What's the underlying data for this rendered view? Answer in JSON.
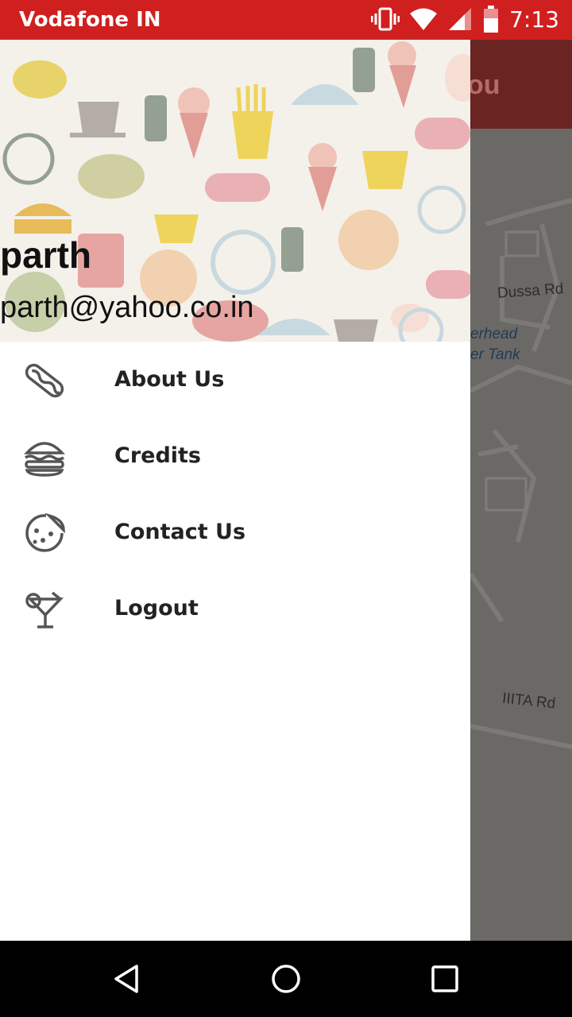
{
  "status_bar": {
    "carrier": "Vodafone IN",
    "time": "7:13",
    "icons": [
      "vibrate-icon",
      "wifi-icon",
      "cell-signal-icon",
      "battery-icon"
    ]
  },
  "background_app": {
    "title_fragment": "ou",
    "map_labels": [
      "Dussa Rd",
      "erhead",
      "er Tank",
      "IIITA Rd"
    ]
  },
  "drawer": {
    "header": {
      "name": "parth",
      "email": "parth@yahoo.co.in"
    },
    "items": [
      {
        "label": "About Us",
        "icon": "hotdog-icon"
      },
      {
        "label": "Credits",
        "icon": "burger-icon"
      },
      {
        "label": "Contact Us",
        "icon": "pizza-icon"
      },
      {
        "label": "Logout",
        "icon": "cocktail-icon"
      }
    ]
  },
  "nav_bar": {
    "buttons": [
      "back-icon",
      "home-icon",
      "recents-icon"
    ]
  },
  "colors": {
    "status_bar": "#d01f1f",
    "toolbar_dim": "#6a2422",
    "map_dim": "#6a6966",
    "header_bg": "#f4f1ea"
  }
}
